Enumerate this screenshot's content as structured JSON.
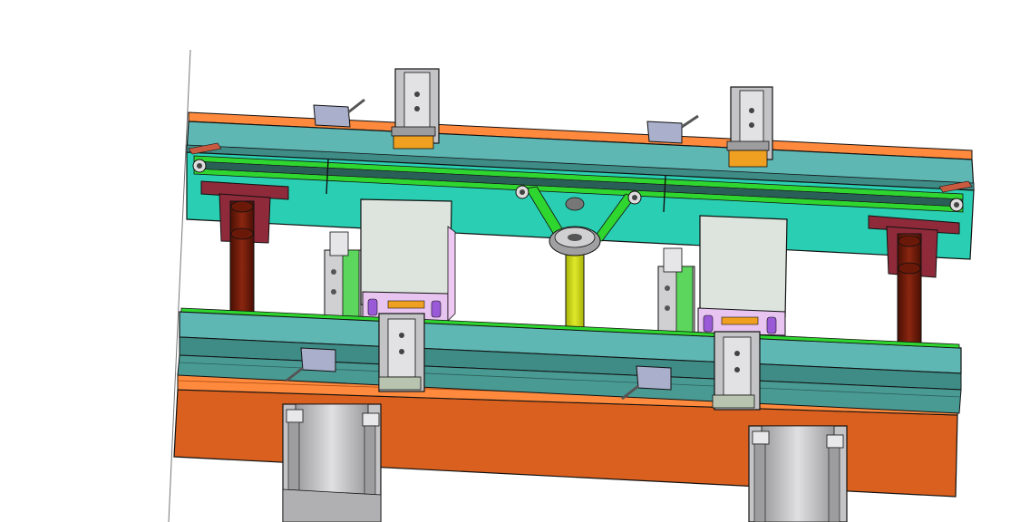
{
  "view": {
    "type": "cad-assembly-render",
    "printed_text": []
  },
  "colors": {
    "background": "#ffffff",
    "teal_rail": "#5fb7b4",
    "teal_plate": "#2acfb3",
    "dark_teal": "#3f8c87",
    "orange_base": "#d9601f",
    "orange_strip": "#ff8a3d",
    "green_belt": "#2fd62f",
    "dark_red_block": "#8e2a3a",
    "rust_shaft": "#7a1e08",
    "yellow_shaft": "#cddc0e",
    "silver": "#c4c4c6",
    "light_panel": "#dde4dd",
    "lavender": "#c9a0e8",
    "gold_pad": "#f0a020",
    "sensor_blue_grey": "#aab0cc",
    "outline": "#111111"
  }
}
